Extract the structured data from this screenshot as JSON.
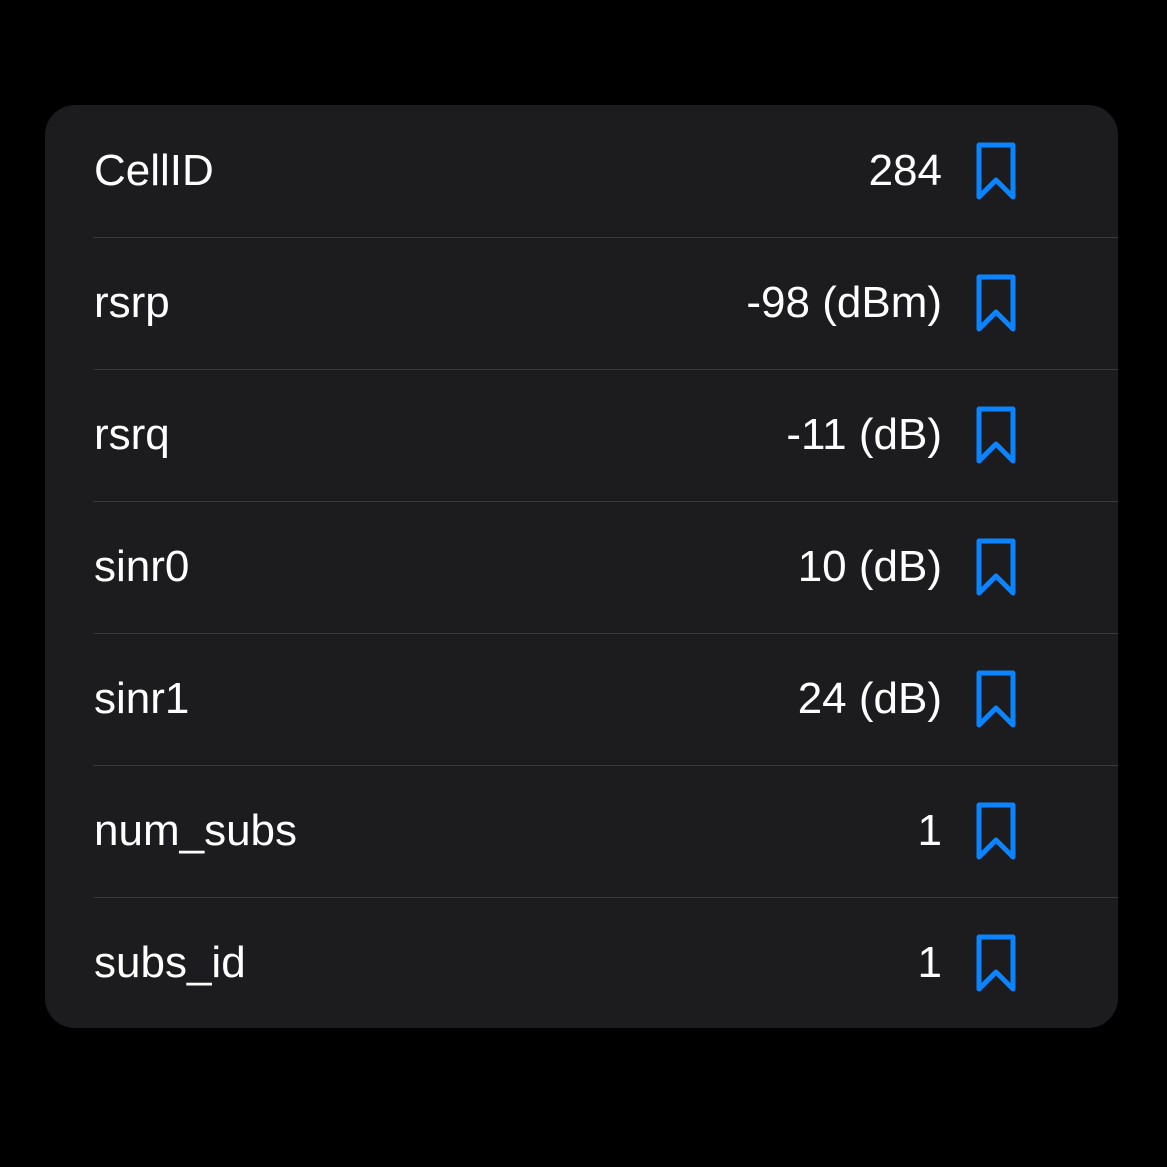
{
  "accent_color": "#0a84ff",
  "rows": [
    {
      "label": "CellID",
      "value": "284",
      "icon": "bookmark-icon"
    },
    {
      "label": "rsrp",
      "value": "-98 (dBm)",
      "icon": "bookmark-icon"
    },
    {
      "label": "rsrq",
      "value": "-11 (dB)",
      "icon": "bookmark-icon"
    },
    {
      "label": "sinr0",
      "value": "10 (dB)",
      "icon": "bookmark-icon"
    },
    {
      "label": "sinr1",
      "value": "24 (dB)",
      "icon": "bookmark-icon"
    },
    {
      "label": "num_subs",
      "value": "1",
      "icon": "bookmark-icon"
    },
    {
      "label": "subs_id",
      "value": "1",
      "icon": "bookmark-icon"
    }
  ]
}
